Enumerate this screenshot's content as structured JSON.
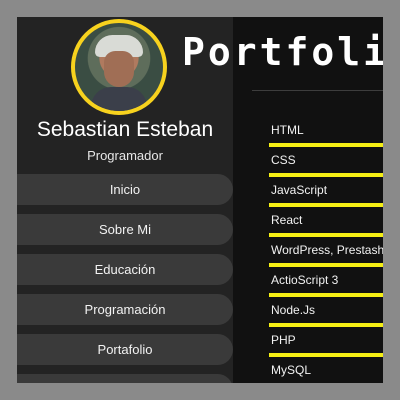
{
  "profile": {
    "name": "Sebastian Esteban",
    "role": "Programador"
  },
  "nav": {
    "items": [
      {
        "label": "Inicio"
      },
      {
        "label": "Sobre Mi"
      },
      {
        "label": "Educación"
      },
      {
        "label": "Programación"
      },
      {
        "label": "Portafolio"
      }
    ]
  },
  "page": {
    "title": "Portfolio"
  },
  "skills": [
    {
      "label": "HTML"
    },
    {
      "label": "CSS"
    },
    {
      "label": "JavaScript"
    },
    {
      "label": "React"
    },
    {
      "label": "WordPress, Prestashop"
    },
    {
      "label": "ActioScript 3"
    },
    {
      "label": "Node.Js"
    },
    {
      "label": "PHP"
    },
    {
      "label": "MySQL"
    }
  ],
  "colors": {
    "accent": "#f5ef14",
    "avatar_border": "#f7d21e",
    "background": "#1f1f1f",
    "nav_item": "#3a3a3a"
  }
}
